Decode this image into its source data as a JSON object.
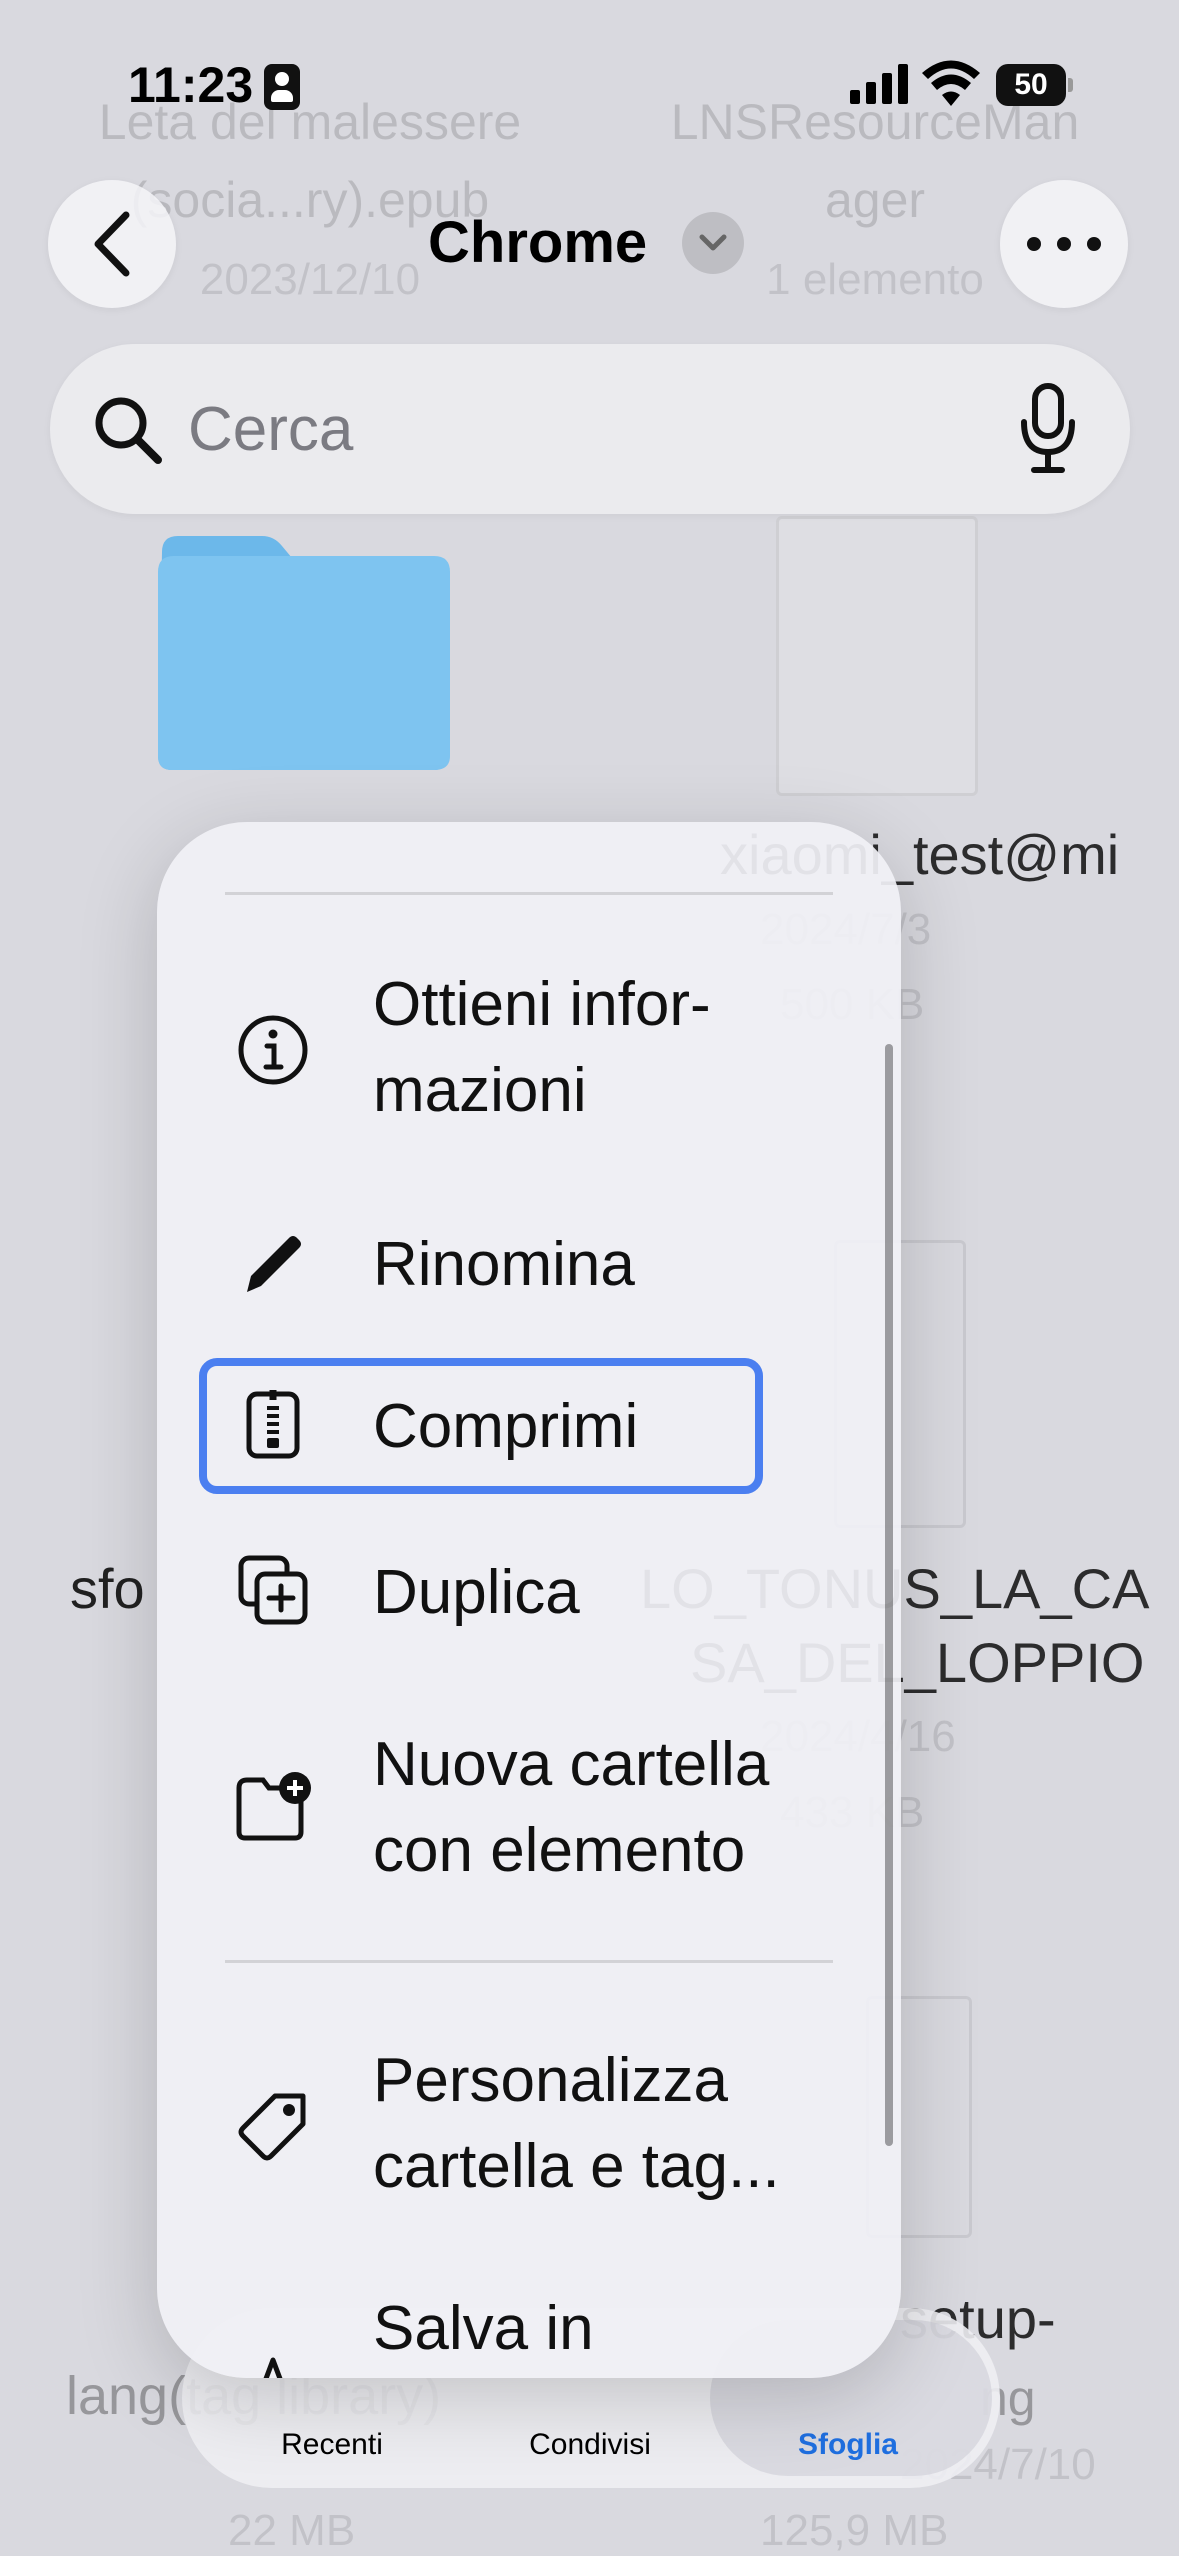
{
  "status_bar": {
    "time": "11:23",
    "battery": "50"
  },
  "header": {
    "title": "Chrome"
  },
  "search": {
    "placeholder": "Cerca"
  },
  "background": {
    "top_left_name_1": "Leta del malessere",
    "top_left_name_2": "(socia...ry).epub",
    "top_left_date": "2023/12/10",
    "top_right_name_1": "LNSResourceMan",
    "top_right_name_2": "ager",
    "top_right_count": "1 elemento",
    "row2_right_name": "xiaomi_test@mi",
    "row2_right_date": "2024/7/3",
    "row2_right_size": "500 KB",
    "row3_left_name": "sfo",
    "row3_right_name_1": "LO_TONUS_LA_CA",
    "row3_right_name_2": "SA_DEL_LOPPIO",
    "row3_right_date": "2024/4/16",
    "row3_right_size": "433 KB",
    "row4_left_name": "lang(tag library)",
    "row4_left_size": "22 MB",
    "row4_right_name_1": "setup-",
    "row4_right_name_2": "ng",
    "row4_right_date": "2024/7/10",
    "row4_right_size": "125,9 MB"
  },
  "menu": {
    "items": [
      {
        "label_1": "Ottieni infor-",
        "label_2": "mazioni",
        "icon": "info-icon"
      },
      {
        "label_1": "Rinomina",
        "icon": "pencil-icon"
      },
      {
        "label_1": "Comprimi",
        "icon": "zip-archive-icon"
      },
      {
        "label_1": "Duplica",
        "icon": "duplicate-icon"
      },
      {
        "label_1": "Nuova cartella",
        "label_2": "con elemento",
        "icon": "new-folder-icon"
      },
      {
        "label_1": "Personalizza",
        "label_2": "cartella e tag...",
        "icon": "tag-icon"
      },
      {
        "label_1": "Salva in",
        "icon": "star-icon"
      }
    ],
    "highlight_color": "#4b7ff0"
  },
  "tabbar": {
    "tabs": [
      {
        "label": "Recenti"
      },
      {
        "label": "Condivisi"
      },
      {
        "label": "Sfoglia"
      }
    ],
    "active_color": "#1f6fe0"
  }
}
